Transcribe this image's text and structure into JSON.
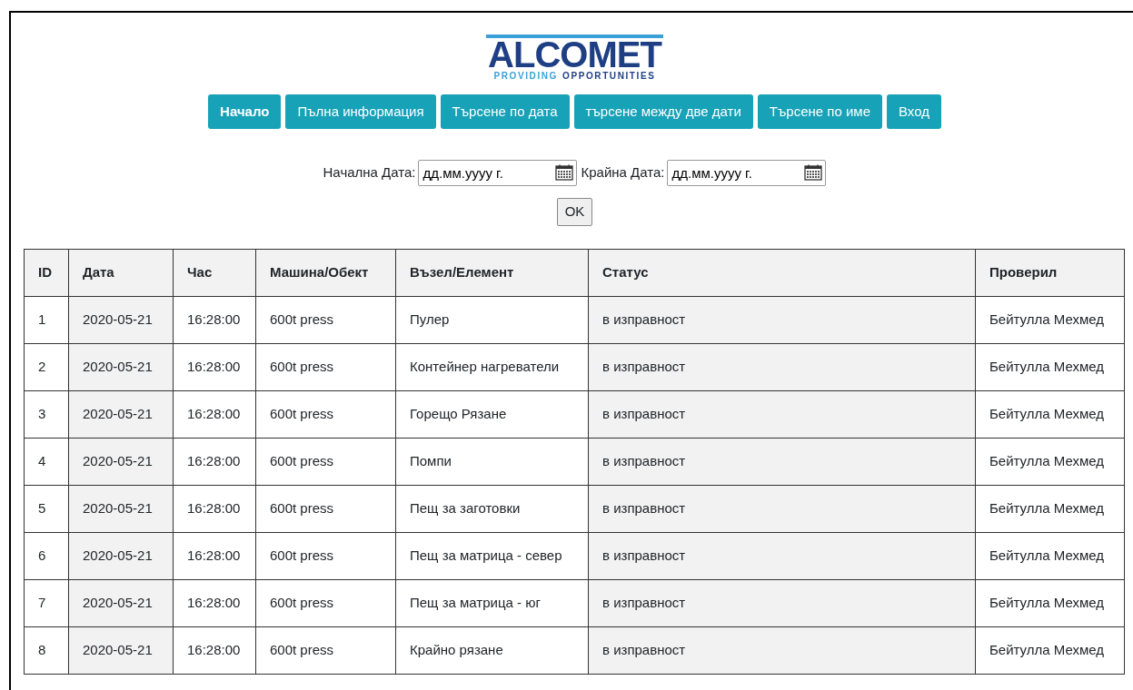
{
  "logo": {
    "name": "ALCOMET",
    "tagline": [
      "PROVIDING",
      "OPPORTUNITIES"
    ]
  },
  "nav": [
    {
      "label": "Начало",
      "selected": true
    },
    {
      "label": "Пълна информация",
      "selected": false
    },
    {
      "label": "Търсене по дата",
      "selected": false
    },
    {
      "label": "търсене между две дати",
      "selected": false
    },
    {
      "label": "Търсене по име",
      "selected": false
    },
    {
      "label": "Вход",
      "selected": false
    }
  ],
  "filter": {
    "fields": [
      {
        "label": "Начална Дата:",
        "placeholder": "дд.мм.уууу г."
      },
      {
        "label": "Крайна Дата:",
        "placeholder": "дд.мм.уууу г."
      }
    ],
    "button": "OK"
  },
  "table": {
    "columns": [
      "ID",
      "Дата",
      "Час",
      "Машина/Обект",
      "Възел/Елемент",
      "Статус",
      "Проверил"
    ],
    "rows": [
      [
        "1",
        "2020-05-21",
        "16:28:00",
        "600t press",
        "Пулер",
        "в изправност",
        "Бейтулла Мехмед"
      ],
      [
        "2",
        "2020-05-21",
        "16:28:00",
        "600t press",
        "Контейнер нагреватели",
        "в изправност",
        "Бейтулла Мехмед"
      ],
      [
        "3",
        "2020-05-21",
        "16:28:00",
        "600t press",
        "Горещо Рязане",
        "в изправност",
        "Бейтулла Мехмед"
      ],
      [
        "4",
        "2020-05-21",
        "16:28:00",
        "600t press",
        "Помпи",
        "в изправност",
        "Бейтулла Мехмед"
      ],
      [
        "5",
        "2020-05-21",
        "16:28:00",
        "600t press",
        "Пещ за заготовки",
        "в изправност",
        "Бейтулла Мехмед"
      ],
      [
        "6",
        "2020-05-21",
        "16:28:00",
        "600t press",
        "Пещ за матрица - север",
        "в изправност",
        "Бейтулла Мехмед"
      ],
      [
        "7",
        "2020-05-21",
        "16:28:00",
        "600t press",
        "Пещ за матрица - юг",
        "в изправност",
        "Бейтулла Мехмед"
      ],
      [
        "8",
        "2020-05-21",
        "16:28:00",
        "600t press",
        "Крайно рязане",
        "в изправност",
        "Бейтулла Мехмед"
      ]
    ]
  }
}
